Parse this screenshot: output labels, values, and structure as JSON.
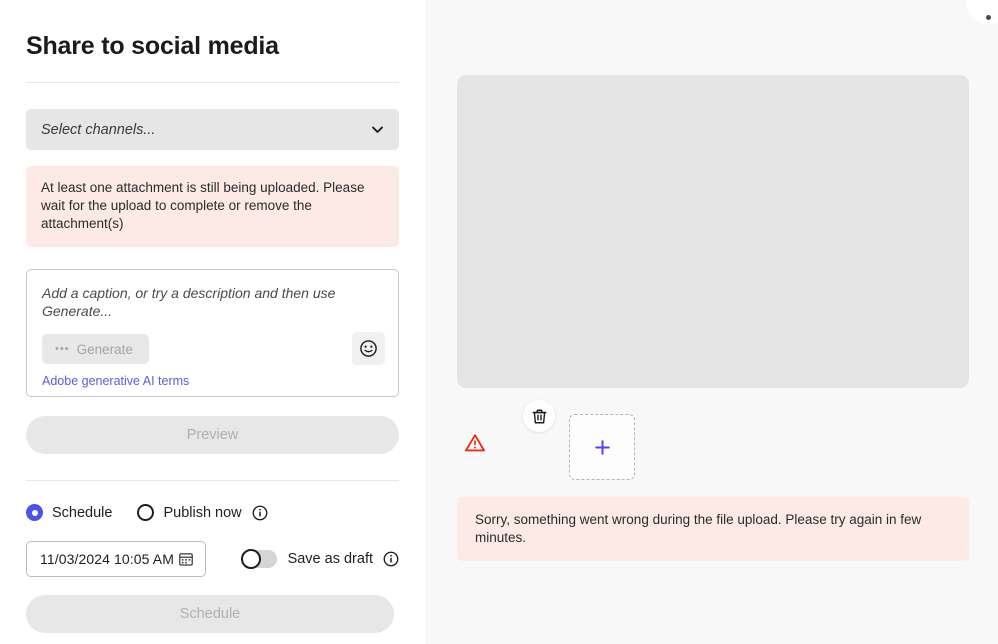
{
  "header": {
    "title": "Share to social media"
  },
  "channels": {
    "placeholder": "Select channels...",
    "chevron_icon": "chevron-down-icon"
  },
  "upload_warning": {
    "message": "At least one attachment is still being uploaded. Please wait for the upload to complete or remove the attachment(s)",
    "background": "#fdeae7"
  },
  "caption": {
    "placeholder": "Add a caption, or try a description and then use Generate...",
    "value": "",
    "generate_label": "Generate",
    "generate_dots": "•••",
    "emoji_icon": "smiley-face-icon",
    "terms_link": "Adobe generative AI terms",
    "terms_color": "#5c5ce0"
  },
  "preview": {
    "label": "Preview",
    "disabled": true
  },
  "publish_options": {
    "schedule_label": "Schedule",
    "publish_now_label": "Publish now",
    "selected": "Schedule",
    "info_icon": "info-circle-icon",
    "accent_color": "#4b54e6"
  },
  "schedule": {
    "datetime_value": "11/03/2024 10:05 AM",
    "calendar_icon": "calendar-icon",
    "save_draft_label": "Save as draft",
    "save_draft_on": false,
    "info_icon": "info-circle-icon"
  },
  "submit": {
    "label": "Schedule",
    "disabled": true
  },
  "media": {
    "placeholder_color": "#e4e4e4",
    "error_icon": "warning-triangle-icon",
    "delete_icon": "trash-icon",
    "add_icon": "plus-icon",
    "add_tile_label": "+"
  },
  "upload_error": {
    "message": "Sorry, something went wrong during the file upload. Please try again in few minutes.",
    "background": "#fdeae7"
  }
}
